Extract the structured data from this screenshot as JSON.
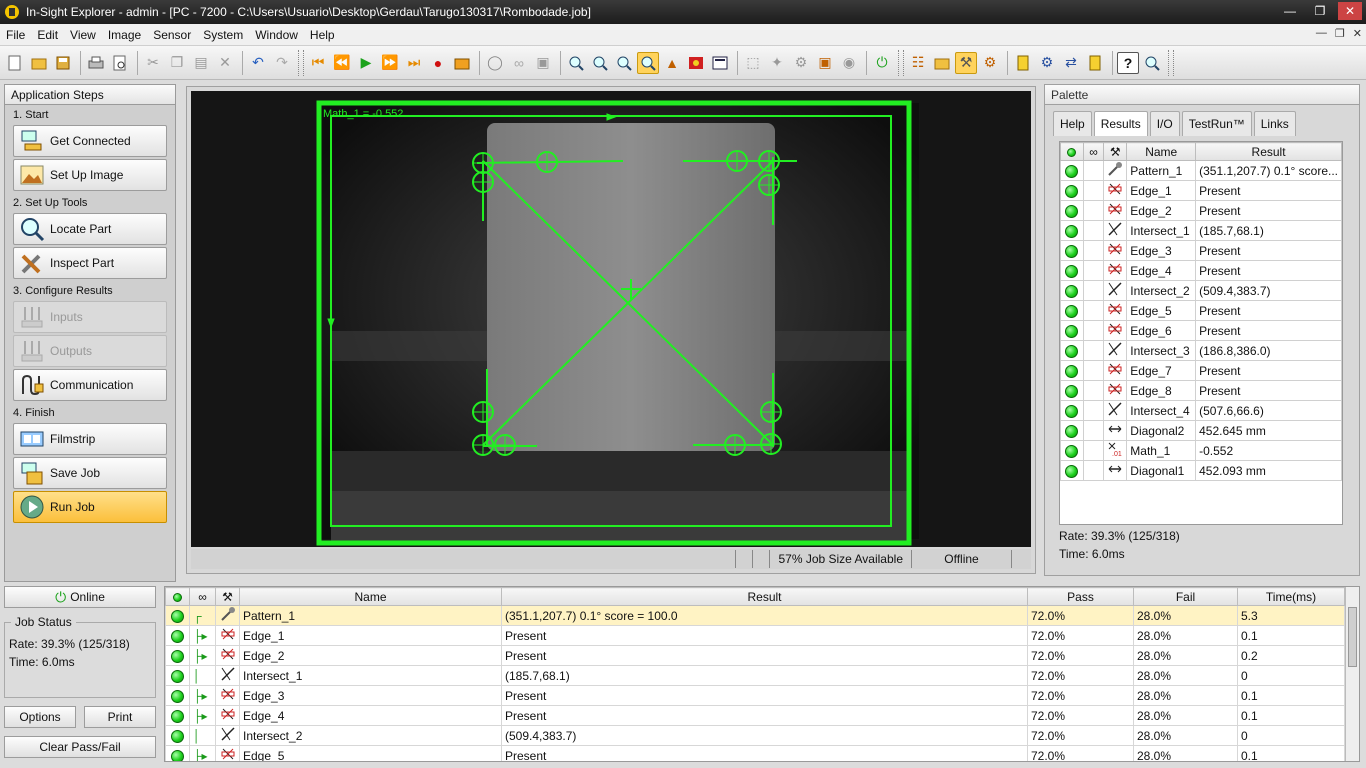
{
  "window": {
    "title": "In-Sight Explorer - admin - [PC - 7200 - C:\\Users\\Usuario\\Desktop\\Gerdau\\Tarugo130317\\Rombodade.job]"
  },
  "menu": [
    "File",
    "Edit",
    "View",
    "Image",
    "Sensor",
    "System",
    "Window",
    "Help"
  ],
  "app_steps": {
    "title": "Application Steps",
    "sections": [
      {
        "title": "1. Start",
        "buttons": [
          "Get Connected",
          "Set Up Image"
        ]
      },
      {
        "title": "2. Set Up Tools",
        "buttons": [
          "Locate Part",
          "Inspect Part"
        ]
      },
      {
        "title": "3. Configure Results",
        "buttons": [
          "Inputs",
          "Outputs",
          "Communication"
        ]
      },
      {
        "title": "4. Finish",
        "buttons": [
          "Filmstrip",
          "Save Job",
          "Run Job"
        ]
      }
    ]
  },
  "image_view": {
    "overlay_label": "Math_1 = -0.552",
    "status": {
      "job_size": "57% Job Size Available",
      "mode": "Offline"
    }
  },
  "palette": {
    "title": "Palette",
    "tabs": [
      "Help",
      "Results",
      "I/O",
      "TestRun™",
      "Links"
    ],
    "active_tab": "Results",
    "columns": [
      "Name",
      "Result"
    ],
    "rows": [
      {
        "name": "Pattern_1",
        "result": "(351.1,207.7) 0.1° score...",
        "icon": "pattern-icon"
      },
      {
        "name": "Edge_1",
        "result": "Present",
        "icon": "edge-icon"
      },
      {
        "name": "Edge_2",
        "result": "Present",
        "icon": "edge-icon"
      },
      {
        "name": "Intersect_1",
        "result": "(185.7,68.1)",
        "icon": "intersect-icon"
      },
      {
        "name": "Edge_3",
        "result": "Present",
        "icon": "edge-icon"
      },
      {
        "name": "Edge_4",
        "result": "Present",
        "icon": "edge-icon"
      },
      {
        "name": "Intersect_2",
        "result": "(509.4,383.7)",
        "icon": "intersect-icon"
      },
      {
        "name": "Edge_5",
        "result": "Present",
        "icon": "edge-icon"
      },
      {
        "name": "Edge_6",
        "result": "Present",
        "icon": "edge-icon"
      },
      {
        "name": "Intersect_3",
        "result": "(186.8,386.0)",
        "icon": "intersect-icon"
      },
      {
        "name": "Edge_7",
        "result": "Present",
        "icon": "edge-icon"
      },
      {
        "name": "Edge_8",
        "result": "Present",
        "icon": "edge-icon"
      },
      {
        "name": "Intersect_4",
        "result": "(507.6,66.6)",
        "icon": "intersect-icon"
      },
      {
        "name": "Diagonal2",
        "result": "452.645 mm",
        "icon": "distance-icon"
      },
      {
        "name": "Math_1",
        "result": "-0.552",
        "icon": "math-icon"
      },
      {
        "name": "Diagonal1",
        "result": "452.093 mm",
        "icon": "distance-icon"
      }
    ],
    "rate": "Rate: 39.3% (125/318)",
    "time": "Time: 6.0ms"
  },
  "bottom": {
    "online_label": "Online",
    "job_status_title": "Job Status",
    "rate": "Rate: 39.3% (125/318)",
    "time": "Time: 6.0ms",
    "options_label": "Options",
    "print_label": "Print",
    "clear_label": "Clear Pass/Fail"
  },
  "results_grid": {
    "columns": [
      "Name",
      "Result",
      "Pass",
      "Fail",
      "Time(ms)"
    ],
    "rows": [
      {
        "name": "Pattern_1",
        "result": "(351.1,207.7) 0.1° score = 100.0",
        "pass": "72.0%",
        "fail": "28.0%",
        "time": "5.3",
        "icon": "pattern-icon"
      },
      {
        "name": "Edge_1",
        "result": "Present",
        "pass": "72.0%",
        "fail": "28.0%",
        "time": "0.1",
        "icon": "edge-icon"
      },
      {
        "name": "Edge_2",
        "result": "Present",
        "pass": "72.0%",
        "fail": "28.0%",
        "time": "0.2",
        "icon": "edge-icon"
      },
      {
        "name": "Intersect_1",
        "result": "(185.7,68.1)",
        "pass": "72.0%",
        "fail": "28.0%",
        "time": "0",
        "icon": "intersect-icon"
      },
      {
        "name": "Edge_3",
        "result": "Present",
        "pass": "72.0%",
        "fail": "28.0%",
        "time": "0.1",
        "icon": "edge-icon"
      },
      {
        "name": "Edge_4",
        "result": "Present",
        "pass": "72.0%",
        "fail": "28.0%",
        "time": "0.1",
        "icon": "edge-icon"
      },
      {
        "name": "Intersect_2",
        "result": "(509.4,383.7)",
        "pass": "72.0%",
        "fail": "28.0%",
        "time": "0",
        "icon": "intersect-icon"
      },
      {
        "name": "Edge_5",
        "result": "Present",
        "pass": "72.0%",
        "fail": "28.0%",
        "time": "0.1",
        "icon": "edge-icon"
      }
    ]
  },
  "colors": {
    "overlay": "#22ee22",
    "status_pass": "#1ed11e",
    "highlight": "#fbbf3b",
    "title_bar": "#2a2a2a"
  }
}
